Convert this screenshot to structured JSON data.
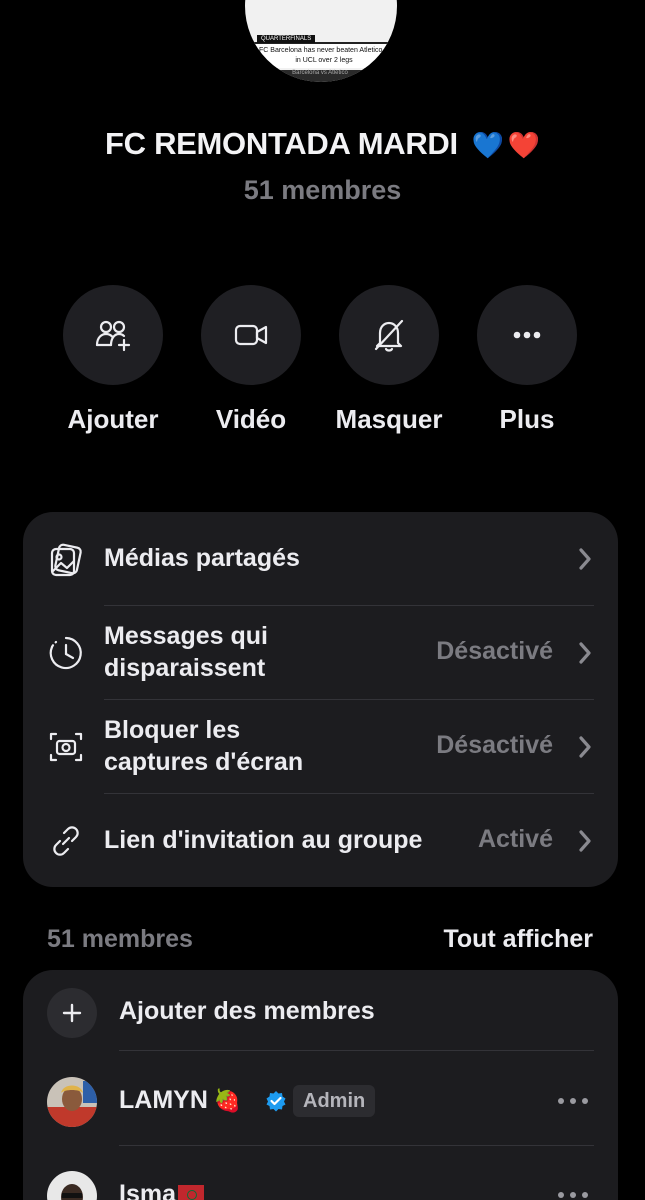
{
  "group": {
    "title": "FC REMONTADA MARDI",
    "emoji_blue_heart": "💙",
    "emoji_red_heart": "❤️",
    "member_count": "51 membres",
    "avatar_banner": {
      "tag": "QUARTERFINALS",
      "line1": "FC Barcelona has never beaten Atletico Madrid",
      "line2": "in UCL over 2 legs",
      "strip": "Barcelona vs Atletico"
    }
  },
  "actions": [
    {
      "label": "Ajouter",
      "icon": "add-people-icon"
    },
    {
      "label": "Vidéo",
      "icon": "video-camera-icon"
    },
    {
      "label": "Masquer",
      "icon": "bell-off-icon"
    },
    {
      "label": "Plus",
      "icon": "more-dots-icon"
    }
  ],
  "settings": [
    {
      "label": "Médias partagés",
      "value": "",
      "icon": "media-gallery-icon"
    },
    {
      "label_line1": "Messages qui",
      "label_line2": "disparaissent",
      "value": "Désactivé",
      "icon": "timer-icon"
    },
    {
      "label_line1": "Bloquer les",
      "label_line2": "captures d'écran",
      "value": "Désactivé",
      "icon": "screenshot-camera-icon"
    },
    {
      "label": "Lien d'invitation au groupe",
      "value": "Activé",
      "icon": "link-icon"
    }
  ],
  "members_section": {
    "count_label": "51 membres",
    "see_all": "Tout afficher",
    "add_label": "Ajouter des membres",
    "members": [
      {
        "name": "LAMYN",
        "emoji": "🍓",
        "verified": true,
        "role": "Admin"
      },
      {
        "name": "Isma",
        "flag": "morocco"
      }
    ]
  },
  "colors": {
    "background": "#000000",
    "card": "#1c1c1f",
    "circle": "#1f1f23",
    "text": "#ececf0",
    "muted": "#7b7b81",
    "verified_blue": "#1d9bf0"
  }
}
